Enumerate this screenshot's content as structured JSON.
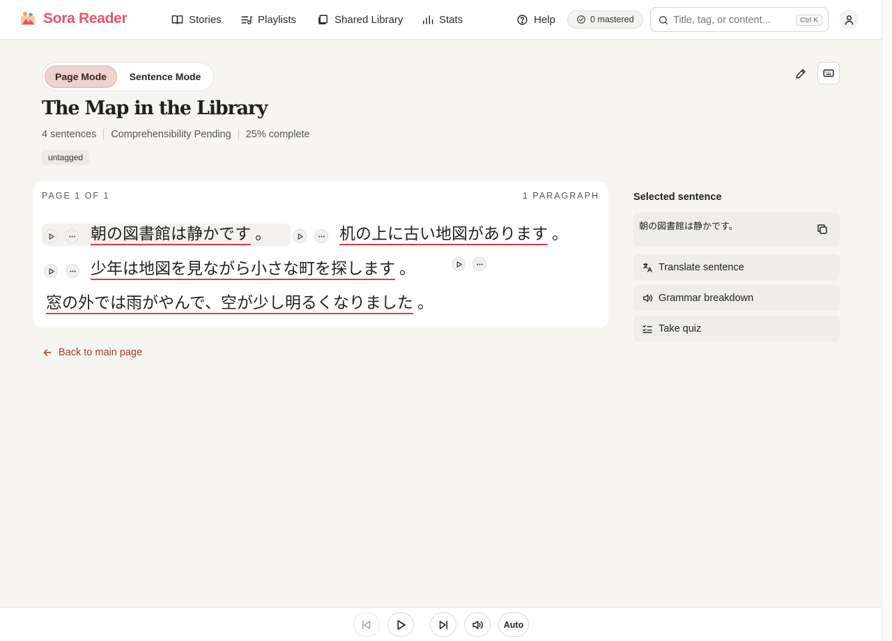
{
  "app": {
    "name": "Sora Reader"
  },
  "nav": {
    "stories": "Stories",
    "playlists": "Playlists",
    "shared_library": "Shared Library",
    "stats": "Stats",
    "help": "Help"
  },
  "mastered_badge": "0 mastered",
  "search": {
    "placeholder": "Title, tag, or content...",
    "shortcut": "Ctrl K"
  },
  "mode": {
    "page": "Page Mode",
    "sentence": "Sentence Mode",
    "active": "page"
  },
  "story": {
    "title": "The Map in the Library",
    "sentence_count": "4 sentences",
    "comprehensibility": "Comprehensibility Pending",
    "progress": "25% complete",
    "tag": "untagged"
  },
  "reader": {
    "page_label": "PAGE 1 OF 1",
    "paragraph_label": "1 PARAGRAPH",
    "sentences": [
      {
        "text": "朝の図書館は静かです",
        "punct": "。"
      },
      {
        "text": "机の上に古い地図があります",
        "punct": "。"
      },
      {
        "text": "少年は地図を見ながら小さな町を探します",
        "punct": "。"
      },
      {
        "text": "窓の外では雨がやんで、空が少し明るくなりました",
        "punct": "。"
      }
    ]
  },
  "back_link": "Back to main page",
  "sidebar": {
    "title": "Selected sentence",
    "selected_text": "朝の図書館は静かです。",
    "actions": {
      "translate": "Translate sentence",
      "grammar": "Grammar breakdown",
      "quiz": "Take quiz"
    }
  },
  "player": {
    "auto": "Auto"
  },
  "colors": {
    "brand": "#e8556b",
    "underline": "#d83a4c",
    "link": "#9a3f2b"
  }
}
